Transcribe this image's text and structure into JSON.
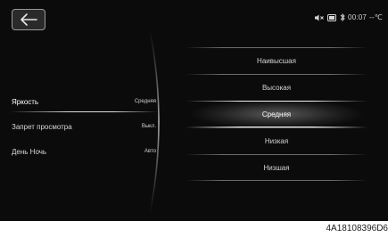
{
  "status": {
    "time": "00:07",
    "temperature": "--℃",
    "icons": [
      "mute-icon",
      "phone-icon",
      "bluetooth-icon"
    ]
  },
  "header": {
    "back_icon": "back-arrow-icon"
  },
  "menu": {
    "items": [
      {
        "label": "Яркость",
        "value": "Средняя",
        "active": true
      },
      {
        "label": "Запрет просмотра",
        "value": "Выкл.",
        "active": false
      },
      {
        "label": "День Ночь",
        "value": "Авто",
        "active": false
      }
    ]
  },
  "options": {
    "items": [
      "Наивысшая",
      "Высокая",
      "Средняя",
      "Низкая",
      "Низшая"
    ],
    "selected": "Средняя"
  },
  "caption": "4A18108396D6"
}
